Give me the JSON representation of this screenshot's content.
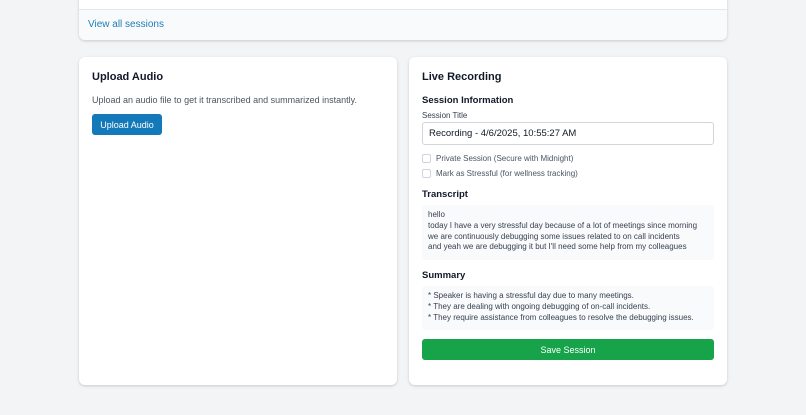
{
  "sessions": {
    "view_all_label": "View all sessions"
  },
  "upload": {
    "title": "Upload Audio",
    "description": "Upload an audio file to get it transcribed and summarized instantly.",
    "button_label": "Upload Audio"
  },
  "live": {
    "title": "Live Recording",
    "session_info_heading": "Session Information",
    "session_title_label": "Session Title",
    "session_title_value": "Recording - 4/6/2025, 10:55:27 AM",
    "private_label": "Private Session (Secure with Midnight)",
    "private_checked": false,
    "stressful_label": "Mark as Stressful (for wellness tracking)",
    "stressful_checked": false,
    "transcript_heading": "Transcript",
    "transcript_lines": [
      "hello",
      "today I have a very stressful day because of a lot of meetings since morning",
      "we are continuously debugging some issues related to on call incidents",
      "and yeah we are debugging it but I'll need some help from my colleagues"
    ],
    "summary_heading": "Summary",
    "summary_lines": [
      "* Speaker is having a stressful day due to many meetings.",
      "* They are dealing with ongoing debugging of on-call incidents.",
      "* They require assistance from colleagues to resolve the debugging issues."
    ],
    "save_label": "Save Session"
  },
  "colors": {
    "page_background": "#f3f4f6",
    "link": "#1c7fb6",
    "primary_button": "#1479b8",
    "save_button": "#16a34a"
  }
}
